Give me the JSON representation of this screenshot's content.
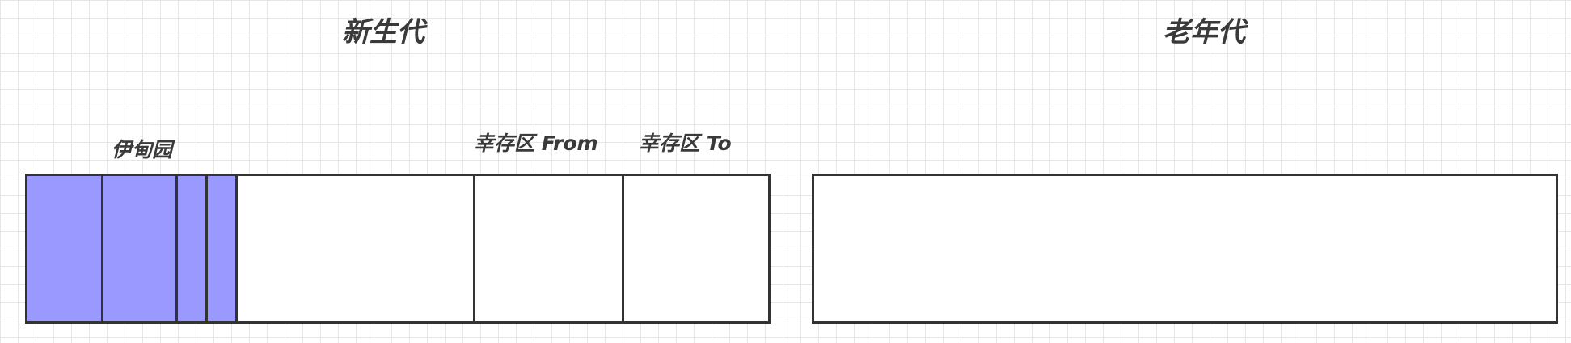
{
  "young_generation": {
    "title": "新生代",
    "eden_label": "伊甸园",
    "survivor_from_label": "幸存区 From",
    "survivor_to_label": "幸存区 To",
    "eden_fill_color": "#9999ff"
  },
  "old_generation": {
    "title": "老年代"
  }
}
